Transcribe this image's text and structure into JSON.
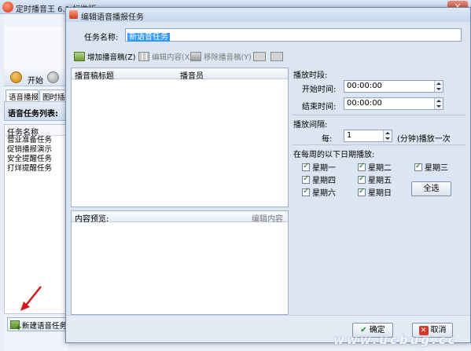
{
  "main_window": {
    "title": "定时播音王 6.1 标准版",
    "toolbar": {
      "start_label": "开始"
    },
    "tabs": [
      "语音播报",
      "图时插播"
    ],
    "task_list_title": "语音任务列表:",
    "task_list": {
      "column": "任务名称",
      "items": [
        "营业准备任务",
        "促销播报演示",
        "安全提醒任务",
        "打烊提醒任务"
      ]
    },
    "new_task_button": "新建语音任务"
  },
  "dialog": {
    "title": "编辑语音播报任务",
    "task_name_label": "任务名称:",
    "task_name_value": "新语音任务",
    "toolbar": {
      "add_script": "增加播音稿(Z)",
      "edit_content": "编辑内容(X)",
      "remove_script": "移除播音稿(Y)"
    },
    "script_table": {
      "columns": [
        "播音稿标题",
        "播音员"
      ]
    },
    "preview": {
      "label": "内容预览:",
      "edit_link": "编辑内容"
    },
    "play_period": {
      "label": "播放时段:",
      "start_label": "开始时间:",
      "start_value": "00:00:00",
      "end_label": "结束时间:",
      "end_value": "00:00:00"
    },
    "interval": {
      "label": "播放间隔:",
      "every_label": "每:",
      "value": "1",
      "unit_text": "(分钟)播放一次"
    },
    "weekly": {
      "label": "在每周的以下日期播放:",
      "days": [
        "星期一",
        "星期二",
        "星期三",
        "星期四",
        "星期五",
        "星期六",
        "星期日"
      ],
      "select_all": "全选"
    },
    "ok_button": "确定",
    "cancel_button": "取消"
  },
  "watermark": "www.ucbug.cc"
}
